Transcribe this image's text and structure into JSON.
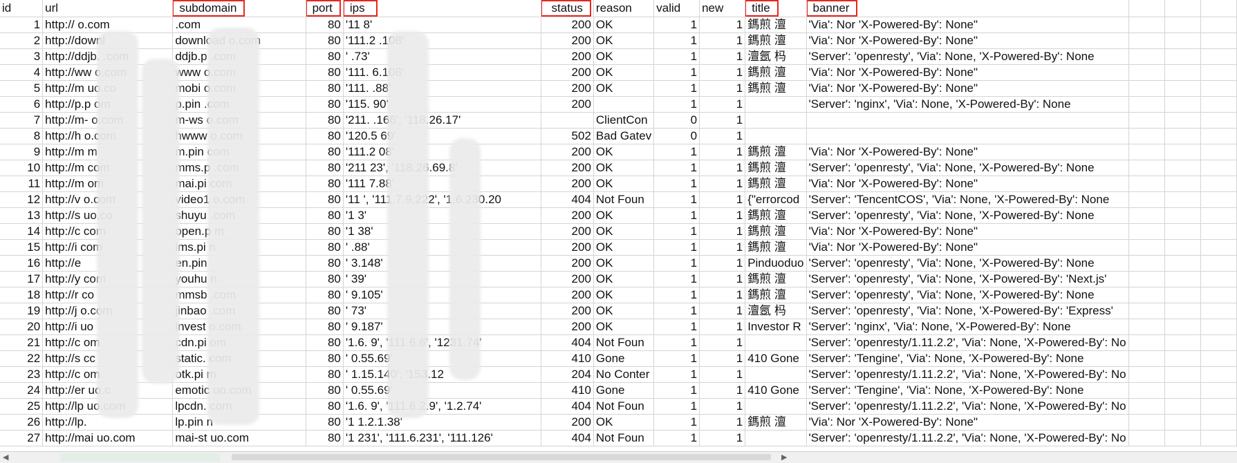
{
  "columns": [
    {
      "key": "id",
      "label": "id",
      "highlight": false
    },
    {
      "key": "url",
      "label": "url",
      "highlight": false
    },
    {
      "key": "subdomain",
      "label": "subdomain",
      "highlight": true
    },
    {
      "key": "port",
      "label": "port",
      "highlight": true
    },
    {
      "key": "ips",
      "label": "ips",
      "highlight": true
    },
    {
      "key": "status",
      "label": "status",
      "highlight": true
    },
    {
      "key": "reason",
      "label": "reason",
      "highlight": false
    },
    {
      "key": "valid",
      "label": "valid",
      "highlight": false
    },
    {
      "key": "new",
      "label": "new",
      "highlight": false
    },
    {
      "key": "title",
      "label": "title",
      "highlight": true
    },
    {
      "key": "banner",
      "label": "banner",
      "highlight": true
    }
  ],
  "rows": [
    {
      "id": "1",
      "url": "http://",
      "url2": "o.com",
      "subdomain": ".com",
      "port": "80",
      "ips": "'11",
      "ips2": "8'",
      "status": "200",
      "reason": "OK",
      "valid": "1",
      "new": "1",
      "title": "鎷煎 澶",
      "banner": "'Via': Nor 'X-Powered-By': None\""
    },
    {
      "id": "2",
      "url": "http://downl",
      "url2": "",
      "subdomain": "download",
      "subdomain2": "o.com",
      "port": "80",
      "ips": "'111.2",
      "ips2": ".108'",
      "status": "200",
      "reason": "OK",
      "valid": "1",
      "new": "1",
      "title": "鎷煎 澶",
      "banner": "'Via': Nor 'X-Powered-By': None\""
    },
    {
      "id": "3",
      "url": "http://ddjb.",
      "url2": ".com",
      "subdomain": "ddjb.p",
      "subdomain2": ".com",
      "port": "80",
      "ips": "'",
      "ips2": ".73'",
      "status": "200",
      "reason": "OK",
      "valid": "1",
      "new": "1",
      "title": "澶氬 杩",
      "banner": "'Server': 'openresty', 'Via': None, 'X-Powered-By': None"
    },
    {
      "id": "4",
      "url": "http://ww",
      "url2": "o.com",
      "subdomain": "www",
      "subdomain2": "o.com",
      "port": "80",
      "ips": "'111.",
      "ips2": "6.108'",
      "status": "200",
      "reason": "OK",
      "valid": "1",
      "new": "1",
      "title": "鎷煎 澶",
      "banner": "'Via': Nor 'X-Powered-By': None\""
    },
    {
      "id": "5",
      "url": "http://m",
      "url2": "uo.co",
      "subdomain": "mobi",
      "subdomain2": "o.com",
      "port": "80",
      "ips": "'111.",
      "ips2": ".88'",
      "status": "200",
      "reason": "OK",
      "valid": "1",
      "new": "1",
      "title": "鎷煎 澶",
      "banner": "'Via': Nor 'X-Powered-By': None\""
    },
    {
      "id": "6",
      "url": "http://p.p",
      "url2": "om",
      "subdomain": "p.pin",
      "subdomain2": ".com",
      "port": "80",
      "ips": "'115.",
      "ips2": "90'",
      "status": "200",
      "reason": "",
      "valid": "1",
      "new": "1",
      "title": "",
      "banner": "'Server': 'nginx', 'Via': None, 'X-Powered-By': None"
    },
    {
      "id": "7",
      "url": "http://m-",
      "url2": "o.com",
      "subdomain": "m-ws",
      "subdomain2": "o.com",
      "port": "80",
      "ips": "'211.",
      "ips2": ".166', '118.26.17'",
      "status": "",
      "reason": "ClientCon",
      "valid": "0",
      "new": "1",
      "title": "",
      "banner": ""
    },
    {
      "id": "8",
      "url": "http://h",
      "url2": "o.com",
      "subdomain": "hwww",
      "subdomain2": "o.com",
      "port": "80",
      "ips": "'120.5",
      "ips2": "69'",
      "status": "502",
      "reason": "Bad Gatev",
      "valid": "0",
      "new": "1",
      "title": "",
      "banner": ""
    },
    {
      "id": "9",
      "url": "http://m",
      "url2": "m",
      "subdomain": "m.pin",
      "subdomain2": "com",
      "port": "80",
      "ips": "'111.2",
      "ips2": "08'",
      "status": "200",
      "reason": "OK",
      "valid": "1",
      "new": "1",
      "title": "鎷煎 澶",
      "banner": "'Via': Nor 'X-Powered-By': None\""
    },
    {
      "id": "10",
      "url": "http://m",
      "url2": "com",
      "subdomain": "mms.p",
      "subdomain2": ".com",
      "port": "80",
      "ips": "'211",
      "ips2": "23', '118.26.69.8'",
      "status": "200",
      "reason": "OK",
      "valid": "1",
      "new": "1",
      "title": "鎷煎 澶",
      "banner": "'Server': 'openresty', 'Via': None, 'X-Powered-By': None"
    },
    {
      "id": "11",
      "url": "http://m",
      "url2": "om",
      "subdomain": "mai.pi",
      "subdomain2": "com",
      "port": "80",
      "ips": "'111",
      "ips2": "7.88'",
      "status": "200",
      "reason": "OK",
      "valid": "1",
      "new": "1",
      "title": "鎷煎 澶",
      "banner": "'Via': Nor 'X-Powered-By': None\""
    },
    {
      "id": "12",
      "url": "http://v",
      "url2": "o.com",
      "subdomain": "video1",
      "subdomain2": "o.com",
      "port": "80",
      "ips": "'11",
      "ips2": "', '111.7.9.222', '1.6.230.20",
      "status": "404",
      "reason": "Not Foun",
      "valid": "1",
      "new": "1",
      "title": "{\"errorcod",
      "banner": "'Server': 'TencentCOS', 'Via': None, 'X-Powered-By': None"
    },
    {
      "id": "13",
      "url": "http://s",
      "url2": "uo.co",
      "subdomain": "shuyu",
      "subdomain2": ".com",
      "port": "80",
      "ips": "'1",
      "ips2": "3'",
      "status": "200",
      "reason": "OK",
      "valid": "1",
      "new": "1",
      "title": "鎷煎 澶",
      "banner": "'Server': 'openresty', 'Via': None, 'X-Powered-By': None"
    },
    {
      "id": "14",
      "url": "http://c",
      "url2": "com",
      "subdomain": "open.p",
      "subdomain2": "m",
      "port": "80",
      "ips": "'1",
      "ips2": "38'",
      "status": "200",
      "reason": "OK",
      "valid": "1",
      "new": "1",
      "title": "鎷煎 澶",
      "banner": "'Via': Nor 'X-Powered-By': None\""
    },
    {
      "id": "15",
      "url": "http://i",
      "url2": "com",
      "subdomain": "ims.pi",
      "subdomain2": "n",
      "port": "80",
      "ips": "'",
      "ips2": ".88'",
      "status": "200",
      "reason": "OK",
      "valid": "1",
      "new": "1",
      "title": "鎷煎 澶",
      "banner": "'Via': Nor 'X-Powered-By': None\""
    },
    {
      "id": "16",
      "url": "http://e",
      "url2": "",
      "subdomain": "en.pin",
      "subdomain2": "",
      "port": "80",
      "ips": "'",
      "ips2": "3.148'",
      "status": "200",
      "reason": "OK",
      "valid": "1",
      "new": "1",
      "title": "Pinduoduo",
      "banner": "'Server': 'openresty', 'Via': None, 'X-Powered-By': None"
    },
    {
      "id": "17",
      "url": "http://y",
      "url2": "com",
      "subdomain": "youhu",
      "subdomain2": "n",
      "port": "80",
      "ips": "'",
      "ips2": "39'",
      "status": "200",
      "reason": "OK",
      "valid": "1",
      "new": "1",
      "title": "鎷煎 澶",
      "banner": "'Server': 'openresty', 'Via': None, 'X-Powered-By': 'Next.js'"
    },
    {
      "id": "18",
      "url": "http://r",
      "url2": "co",
      "subdomain": "mmsb",
      "subdomain2": ".com",
      "port": "80",
      "ips": "'",
      "ips2": "9.105'",
      "status": "200",
      "reason": "OK",
      "valid": "1",
      "new": "1",
      "title": "鎷煎 澶",
      "banner": "'Server': 'openresty', 'Via': None, 'X-Powered-By': None"
    },
    {
      "id": "19",
      "url": "http://j",
      "url2": "o.com",
      "subdomain": "jinbao",
      "subdomain2": ".com",
      "port": "80",
      "ips": "'",
      "ips2": "73'",
      "status": "200",
      "reason": "OK",
      "valid": "1",
      "new": "1",
      "title": "澶氬 杩",
      "banner": "'Server': 'openresty', 'Via': None, 'X-Powered-By': 'Express'"
    },
    {
      "id": "20",
      "url": "http://i",
      "url2": "uo",
      "subdomain": "invest",
      "subdomain2": "o.com",
      "port": "80",
      "ips": "'",
      "ips2": "9.187'",
      "status": "200",
      "reason": "OK",
      "valid": "1",
      "new": "1",
      "title": "Investor R",
      "banner": "'Server': 'nginx', 'Via': None, 'X-Powered-By': None"
    },
    {
      "id": "21",
      "url": "http://c",
      "url2": "om",
      "subdomain": "cdn.pi",
      "subdomain2": "om",
      "port": "80",
      "ips": "'1.6.",
      "ips2": "9', '111.6.6', '1231.74'",
      "status": "404",
      "reason": "Not Foun",
      "valid": "1",
      "new": "1",
      "title": "",
      "banner": "'Server': 'openresty/1.11.2.2', 'Via': None, 'X-Powered-By': No"
    },
    {
      "id": "22",
      "url": "http://s",
      "url2": "cc",
      "subdomain": "static.",
      "subdomain2": "com",
      "port": "80",
      "ips": "'",
      "ips2": "0.55.69'",
      "status": "410",
      "reason": "Gone",
      "valid": "1",
      "new": "1",
      "title": "410 Gone",
      "banner": "'Server': 'Tengine', 'Via': None, 'X-Powered-By': None"
    },
    {
      "id": "23",
      "url": "http://c",
      "url2": "om",
      "subdomain": "otk.pi",
      "subdomain2": "m",
      "port": "80",
      "ips": "'",
      "ips2": "1.15.140', '153.12",
      "status": "204",
      "reason": "No Conter",
      "valid": "1",
      "new": "1",
      "title": "",
      "banner": "'Server': 'openresty/1.11.2.2', 'Via': None, 'X-Powered-By': No"
    },
    {
      "id": "24",
      "url": "http://er",
      "url2": "uo.c",
      "subdomain": "emotic",
      "subdomain2": "uo.com",
      "port": "80",
      "ips": "'",
      "ips2": "0.55.69'",
      "status": "410",
      "reason": "Gone",
      "valid": "1",
      "new": "1",
      "title": "410 Gone",
      "banner": "'Server': 'Tengine', 'Via': None, 'X-Powered-By': None"
    },
    {
      "id": "25",
      "url": "http://lp",
      "url2": "uo.com",
      "subdomain": "lpcdn.",
      "subdomain2": "com",
      "port": "80",
      "ips": "'1.6.",
      "ips2": "9', '111.6.2.9', '1.2.74'",
      "status": "404",
      "reason": "Not Foun",
      "valid": "1",
      "new": "1",
      "title": "",
      "banner": "'Server': 'openresty/1.11.2.2', 'Via': None, 'X-Powered-By': No"
    },
    {
      "id": "26",
      "url": "http://lp.",
      "url2": "",
      "subdomain": "lp.pin",
      "subdomain2": "n",
      "port": "80",
      "ips": "'1",
      "ips2": "1.2.1.38'",
      "status": "200",
      "reason": "OK",
      "valid": "1",
      "new": "1",
      "title": "鎷煎 澶",
      "banner": "'Via': Nor 'X-Powered-By': None\""
    },
    {
      "id": "27",
      "url": "http://mai",
      "url2": "uo.com",
      "subdomain": "mai-st",
      "subdomain2": "uo.com",
      "port": "80",
      "ips": "'1",
      "ips2": "231', '111.6.231', '111.126'",
      "status": "404",
      "reason": "Not Foun",
      "valid": "1",
      "new": "1",
      "title": "",
      "banner": "'Server': 'openresty/1.11.2.2', 'Via': None, 'X-Powered-By': No"
    }
  ],
  "colors": {
    "highlight_border": "#e8251f",
    "grid_line": "#d4d4d4"
  }
}
